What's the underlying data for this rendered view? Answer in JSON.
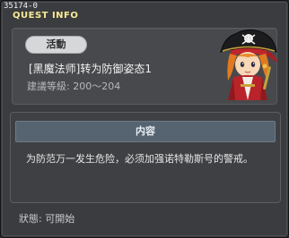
{
  "header": {
    "quest_id": "35174-0",
    "title": "QUEST INFO"
  },
  "quest": {
    "status_label": "活動",
    "name": "[黑魔法师]转为防御姿态1",
    "required_level": "建議等級: 200～204",
    "npc_portrait": "pirate-captain-portrait"
  },
  "content": {
    "header_label": "内容",
    "text": "为防范万一发生危险，必须加强诺特勒斯号的警戒。"
  },
  "footer": {
    "status_text": "狀態:  可開始"
  },
  "colors": {
    "window_bg": "#3b3c3f",
    "panel_bg": "#47494c",
    "title_gold": "#f4e9a0",
    "content_header_bg": "#566471",
    "pill_bg": "#d6d7d8"
  }
}
